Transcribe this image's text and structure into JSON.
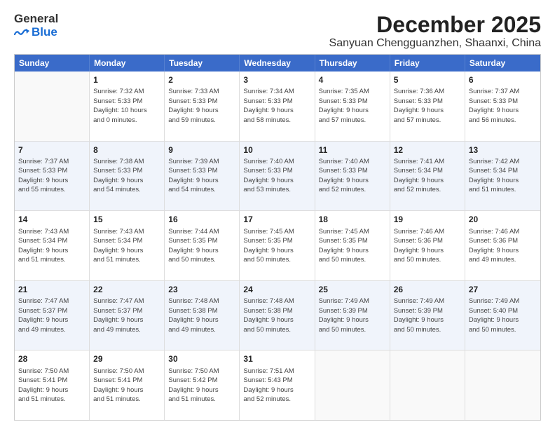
{
  "logo": {
    "line1": "General",
    "line2": "Blue"
  },
  "title": "December 2025",
  "location": "Sanyuan Chengguanzhen, Shaanxi, China",
  "days_header": [
    "Sunday",
    "Monday",
    "Tuesday",
    "Wednesday",
    "Thursday",
    "Friday",
    "Saturday"
  ],
  "weeks": [
    [
      {
        "day": "",
        "text": ""
      },
      {
        "day": "1",
        "text": "Sunrise: 7:32 AM\nSunset: 5:33 PM\nDaylight: 10 hours\nand 0 minutes."
      },
      {
        "day": "2",
        "text": "Sunrise: 7:33 AM\nSunset: 5:33 PM\nDaylight: 9 hours\nand 59 minutes."
      },
      {
        "day": "3",
        "text": "Sunrise: 7:34 AM\nSunset: 5:33 PM\nDaylight: 9 hours\nand 58 minutes."
      },
      {
        "day": "4",
        "text": "Sunrise: 7:35 AM\nSunset: 5:33 PM\nDaylight: 9 hours\nand 57 minutes."
      },
      {
        "day": "5",
        "text": "Sunrise: 7:36 AM\nSunset: 5:33 PM\nDaylight: 9 hours\nand 57 minutes."
      },
      {
        "day": "6",
        "text": "Sunrise: 7:37 AM\nSunset: 5:33 PM\nDaylight: 9 hours\nand 56 minutes."
      }
    ],
    [
      {
        "day": "7",
        "text": "Sunrise: 7:37 AM\nSunset: 5:33 PM\nDaylight: 9 hours\nand 55 minutes."
      },
      {
        "day": "8",
        "text": "Sunrise: 7:38 AM\nSunset: 5:33 PM\nDaylight: 9 hours\nand 54 minutes."
      },
      {
        "day": "9",
        "text": "Sunrise: 7:39 AM\nSunset: 5:33 PM\nDaylight: 9 hours\nand 54 minutes."
      },
      {
        "day": "10",
        "text": "Sunrise: 7:40 AM\nSunset: 5:33 PM\nDaylight: 9 hours\nand 53 minutes."
      },
      {
        "day": "11",
        "text": "Sunrise: 7:40 AM\nSunset: 5:33 PM\nDaylight: 9 hours\nand 52 minutes."
      },
      {
        "day": "12",
        "text": "Sunrise: 7:41 AM\nSunset: 5:34 PM\nDaylight: 9 hours\nand 52 minutes."
      },
      {
        "day": "13",
        "text": "Sunrise: 7:42 AM\nSunset: 5:34 PM\nDaylight: 9 hours\nand 51 minutes."
      }
    ],
    [
      {
        "day": "14",
        "text": "Sunrise: 7:43 AM\nSunset: 5:34 PM\nDaylight: 9 hours\nand 51 minutes."
      },
      {
        "day": "15",
        "text": "Sunrise: 7:43 AM\nSunset: 5:34 PM\nDaylight: 9 hours\nand 51 minutes."
      },
      {
        "day": "16",
        "text": "Sunrise: 7:44 AM\nSunset: 5:35 PM\nDaylight: 9 hours\nand 50 minutes."
      },
      {
        "day": "17",
        "text": "Sunrise: 7:45 AM\nSunset: 5:35 PM\nDaylight: 9 hours\nand 50 minutes."
      },
      {
        "day": "18",
        "text": "Sunrise: 7:45 AM\nSunset: 5:35 PM\nDaylight: 9 hours\nand 50 minutes."
      },
      {
        "day": "19",
        "text": "Sunrise: 7:46 AM\nSunset: 5:36 PM\nDaylight: 9 hours\nand 50 minutes."
      },
      {
        "day": "20",
        "text": "Sunrise: 7:46 AM\nSunset: 5:36 PM\nDaylight: 9 hours\nand 49 minutes."
      }
    ],
    [
      {
        "day": "21",
        "text": "Sunrise: 7:47 AM\nSunset: 5:37 PM\nDaylight: 9 hours\nand 49 minutes."
      },
      {
        "day": "22",
        "text": "Sunrise: 7:47 AM\nSunset: 5:37 PM\nDaylight: 9 hours\nand 49 minutes."
      },
      {
        "day": "23",
        "text": "Sunrise: 7:48 AM\nSunset: 5:38 PM\nDaylight: 9 hours\nand 49 minutes."
      },
      {
        "day": "24",
        "text": "Sunrise: 7:48 AM\nSunset: 5:38 PM\nDaylight: 9 hours\nand 50 minutes."
      },
      {
        "day": "25",
        "text": "Sunrise: 7:49 AM\nSunset: 5:39 PM\nDaylight: 9 hours\nand 50 minutes."
      },
      {
        "day": "26",
        "text": "Sunrise: 7:49 AM\nSunset: 5:39 PM\nDaylight: 9 hours\nand 50 minutes."
      },
      {
        "day": "27",
        "text": "Sunrise: 7:49 AM\nSunset: 5:40 PM\nDaylight: 9 hours\nand 50 minutes."
      }
    ],
    [
      {
        "day": "28",
        "text": "Sunrise: 7:50 AM\nSunset: 5:41 PM\nDaylight: 9 hours\nand 51 minutes."
      },
      {
        "day": "29",
        "text": "Sunrise: 7:50 AM\nSunset: 5:41 PM\nDaylight: 9 hours\nand 51 minutes."
      },
      {
        "day": "30",
        "text": "Sunrise: 7:50 AM\nSunset: 5:42 PM\nDaylight: 9 hours\nand 51 minutes."
      },
      {
        "day": "31",
        "text": "Sunrise: 7:51 AM\nSunset: 5:43 PM\nDaylight: 9 hours\nand 52 minutes."
      },
      {
        "day": "",
        "text": ""
      },
      {
        "day": "",
        "text": ""
      },
      {
        "day": "",
        "text": ""
      }
    ]
  ]
}
